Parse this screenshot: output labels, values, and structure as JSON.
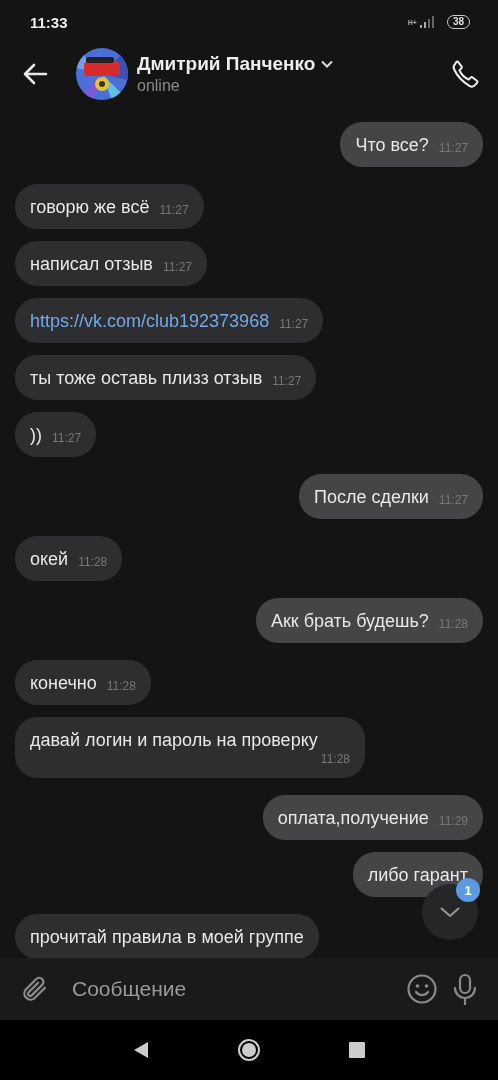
{
  "status_bar": {
    "time": "11:33",
    "network": "H+",
    "battery": "38"
  },
  "header": {
    "name": "Дмитрий Панченко",
    "status": "online"
  },
  "messages": [
    {
      "outgoing": true,
      "kind": "text",
      "text": "Что все?",
      "time": "11:27"
    },
    {
      "outgoing": false,
      "kind": "text",
      "text": "говорю же всё",
      "time": "11:27"
    },
    {
      "outgoing": false,
      "kind": "text",
      "text": "написал отзыв",
      "time": "11:27"
    },
    {
      "outgoing": false,
      "kind": "link",
      "text": "https://vk.com/club192373968",
      "time": "11:27"
    },
    {
      "outgoing": false,
      "kind": "text",
      "text": "ты тоже оставь плизз отзыв",
      "time": "11:27"
    },
    {
      "outgoing": false,
      "kind": "text",
      "text": "))",
      "time": "11:27"
    },
    {
      "outgoing": true,
      "kind": "text",
      "text": "После сделки",
      "time": "11:27"
    },
    {
      "outgoing": false,
      "kind": "text",
      "text": "окей",
      "time": "11:28"
    },
    {
      "outgoing": true,
      "kind": "text",
      "text": "Акк брать будешь?",
      "time": "11:28"
    },
    {
      "outgoing": false,
      "kind": "text",
      "text": "конечно",
      "time": "11:28"
    },
    {
      "outgoing": false,
      "kind": "text",
      "text": "давай логин и пароль на проверку",
      "time": "11:28"
    },
    {
      "outgoing": true,
      "kind": "text",
      "text": "оплата,получение",
      "time": "11:29"
    },
    {
      "outgoing": true,
      "kind": "text",
      "text": "либо гарант"
    },
    {
      "outgoing": false,
      "kind": "text",
      "text": "прочитай правила в моей группе"
    }
  ],
  "scroll_button": {
    "badge": "1"
  },
  "composer": {
    "placeholder": "Сообщение"
  }
}
